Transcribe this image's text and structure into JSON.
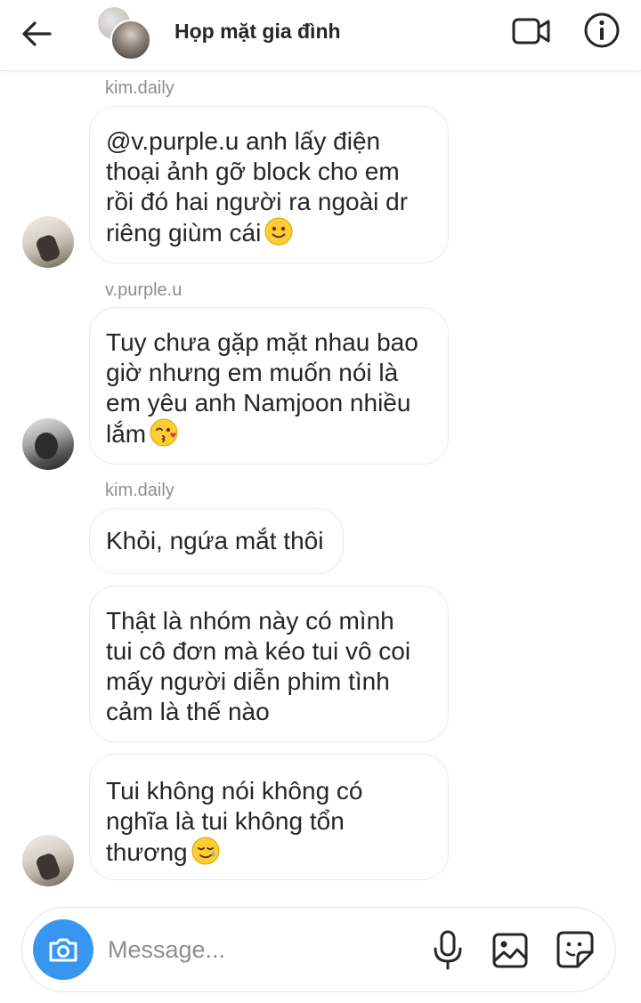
{
  "header": {
    "title": "Họp mặt gia đình",
    "icons": [
      "back-arrow-icon",
      "video-call-icon",
      "info-icon"
    ]
  },
  "messages": [
    {
      "sender": "kim.daily",
      "bubbles": [
        {
          "lines": [
            "@v.purple.u anh lấy điện",
            "thoại ảnh gỡ block cho em",
            "rồi đó hai người ra ngoài dr",
            "riêng giùm cái"
          ],
          "emoji": "slightly-smiling-face"
        }
      ]
    },
    {
      "sender": "v.purple.u",
      "bubbles": [
        {
          "lines": [
            "Tuy chưa gặp mặt nhau bao",
            "giờ nhưng em muốn nói là",
            "em yêu anh Namjoon nhiều",
            "lắm"
          ],
          "emoji": "face-blowing-kiss"
        }
      ]
    },
    {
      "sender": "kim.daily",
      "bubbles": [
        {
          "lines": [
            "Khỏi, ngứa mắt thôi"
          ]
        },
        {
          "lines": [
            "Thật là nhóm này có mình",
            "tui cô đơn mà kéo tui vô coi",
            "mấy người diễn phim tình",
            "cảm là thế nào"
          ]
        },
        {
          "lines": [
            "Tui không nói không có",
            "nghĩa là tui không tổn",
            "thương"
          ],
          "emoji": "smiling-face-with-tear"
        }
      ]
    }
  ],
  "composer": {
    "placeholder": "Message...",
    "icons": [
      "camera-icon",
      "microphone-icon",
      "gallery-icon",
      "sticker-icon"
    ]
  },
  "colors": {
    "accent": "#3797f0",
    "bubble_border": "#ececec",
    "meta_text": "#8e8e8e"
  }
}
